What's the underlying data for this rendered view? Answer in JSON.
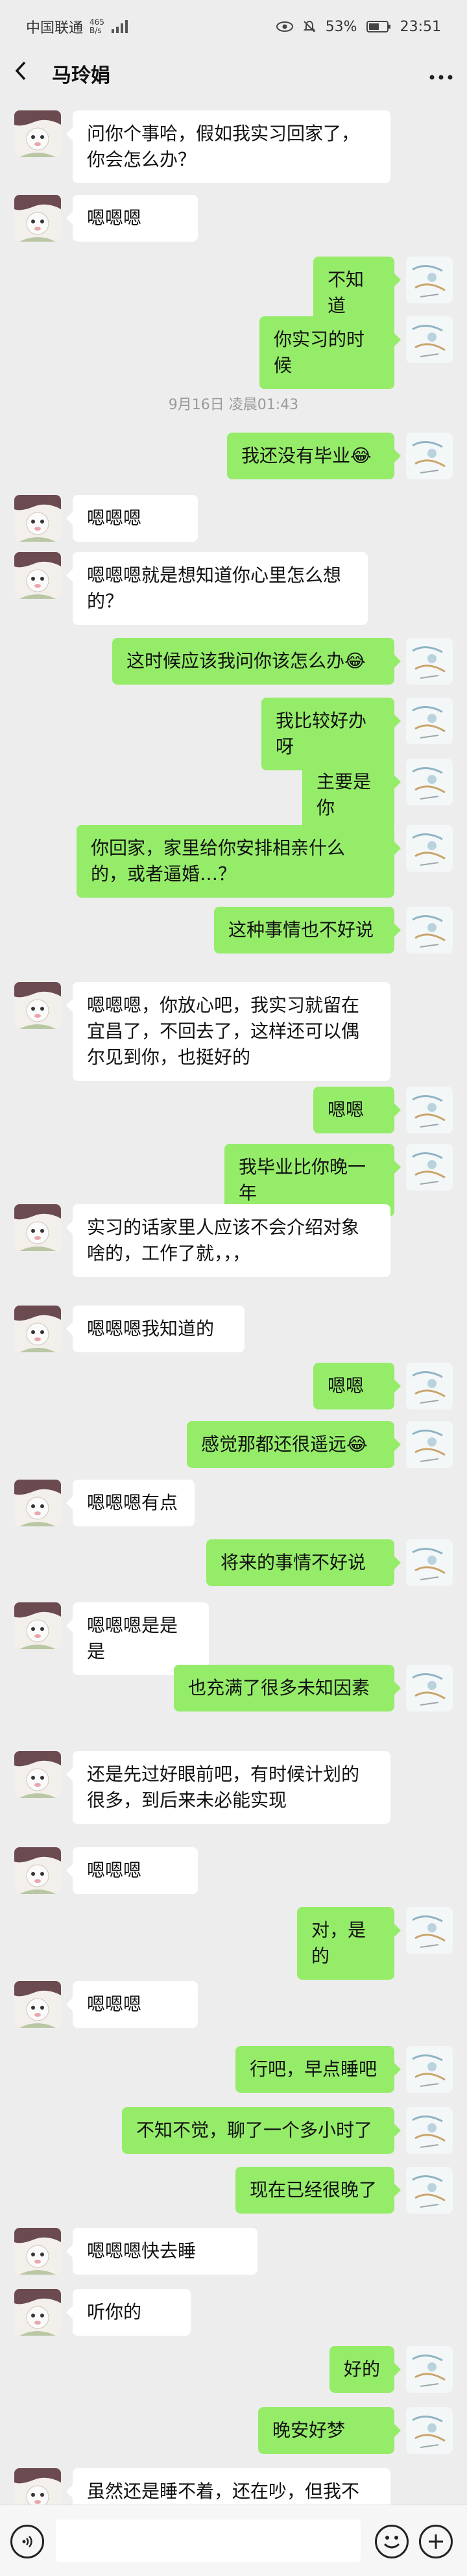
{
  "status_bar": {
    "carrier": "中国联通",
    "network_speed": "465\nB/s",
    "battery": "53%",
    "time": "23:51"
  },
  "header": {
    "back_icon": "chevron-left-icon",
    "title": "马玲娟",
    "more_icon": "ellipsis-icon"
  },
  "messages": [
    {
      "from": "other",
      "text": "问你个事哈，假如我实习回家了，你会怎么办？"
    },
    {
      "from": "other",
      "text": "嗯嗯嗯"
    },
    {
      "from": "me",
      "text": "不知道"
    },
    {
      "from": "me",
      "text": "你实习的时候"
    },
    {
      "type": "timestamp",
      "text": "9月16日 凌晨01:43"
    },
    {
      "from": "me",
      "text": "我还没有毕业😂"
    },
    {
      "from": "other",
      "text": "嗯嗯嗯"
    },
    {
      "from": "other",
      "text": "嗯嗯嗯就是想知道你心里怎么想的？"
    },
    {
      "from": "me",
      "text": "这时候应该我问你该怎么办😂"
    },
    {
      "from": "me",
      "text": "我比较好办呀"
    },
    {
      "from": "me",
      "text": "主要是你"
    },
    {
      "from": "me",
      "text": "你回家，家里给你安排相亲什么的，或者逼婚…？"
    },
    {
      "from": "me",
      "text": "这种事情也不好说"
    },
    {
      "from": "other",
      "text": "嗯嗯嗯，你放心吧，我实习就留在宜昌了，不回去了，这样还可以偶尔见到你，也挺好的"
    },
    {
      "from": "me",
      "text": "嗯嗯"
    },
    {
      "from": "me",
      "text": "我毕业比你晚一年"
    },
    {
      "from": "other",
      "text": "实习的话家里人应该不会介绍对象啥的，工作了就，，，"
    },
    {
      "from": "other",
      "text": "嗯嗯嗯我知道的"
    },
    {
      "from": "me",
      "text": "嗯嗯"
    },
    {
      "from": "me",
      "text": "感觉那都还很遥远😂"
    },
    {
      "from": "other",
      "text": "嗯嗯嗯有点"
    },
    {
      "from": "me",
      "text": "将来的事情不好说"
    },
    {
      "from": "other",
      "text": "嗯嗯嗯是是是"
    },
    {
      "from": "me",
      "text": "也充满了很多未知因素"
    },
    {
      "from": "other",
      "text": "还是先过好眼前吧，有时候计划的很多，到后来未必能实现"
    },
    {
      "from": "other",
      "text": "嗯嗯嗯"
    },
    {
      "from": "me",
      "text": "对，是的"
    },
    {
      "from": "other",
      "text": "嗯嗯嗯"
    },
    {
      "from": "me",
      "text": "行吧，早点睡吧"
    },
    {
      "from": "me",
      "text": "不知不觉，聊了一个多小时了"
    },
    {
      "from": "me",
      "text": "现在已经很晚了"
    },
    {
      "from": "other",
      "text": "嗯嗯嗯快去睡"
    },
    {
      "from": "other",
      "text": "听你的"
    },
    {
      "from": "me",
      "text": "好的"
    },
    {
      "from": "me",
      "text": "晚安好梦"
    },
    {
      "from": "other",
      "text": "虽然还是睡不着，还在吵，但我不"
    }
  ],
  "input_bar": {
    "voice_icon": "voice-icon",
    "input_value": "",
    "emoji_icon": "emoji-icon",
    "plus_icon": "plus-icon"
  },
  "colors": {
    "background": "#ededed",
    "my_bubble": "#95ec69",
    "other_bubble": "#ffffff",
    "timestamp_text": "#9a9a9a"
  }
}
